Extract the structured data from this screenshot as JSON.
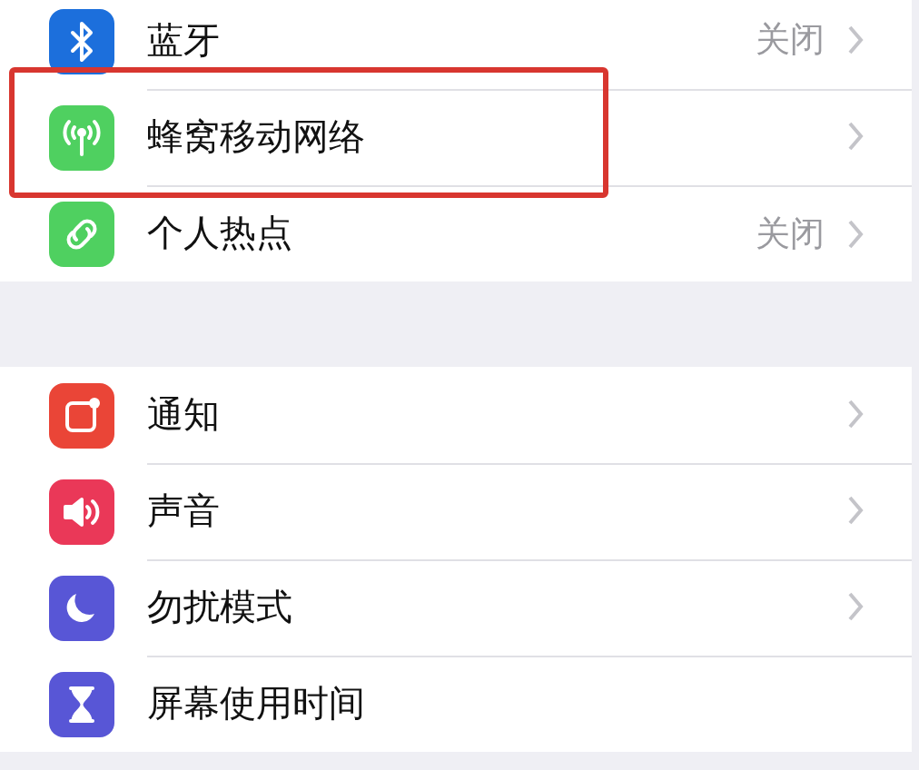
{
  "groups": [
    {
      "items": [
        {
          "kind": "bluetooth",
          "label": "蓝牙",
          "value": "关闭",
          "chevron": true,
          "highlighted": false
        },
        {
          "kind": "cellular",
          "label": "蜂窝移动网络",
          "chevron": true,
          "highlighted": true
        },
        {
          "kind": "hotspot",
          "label": "个人热点",
          "value": "关闭",
          "chevron": true,
          "highlighted": false
        }
      ]
    },
    {
      "items": [
        {
          "kind": "notifications",
          "label": "通知",
          "chevron": true,
          "highlighted": false
        },
        {
          "kind": "sounds",
          "label": "声音",
          "chevron": true,
          "highlighted": false
        },
        {
          "kind": "dnd",
          "label": "勿扰模式",
          "chevron": true,
          "highlighted": false
        },
        {
          "kind": "screentime",
          "label": "屏幕使用时间",
          "chevron": false,
          "highlighted": false
        }
      ]
    }
  ]
}
